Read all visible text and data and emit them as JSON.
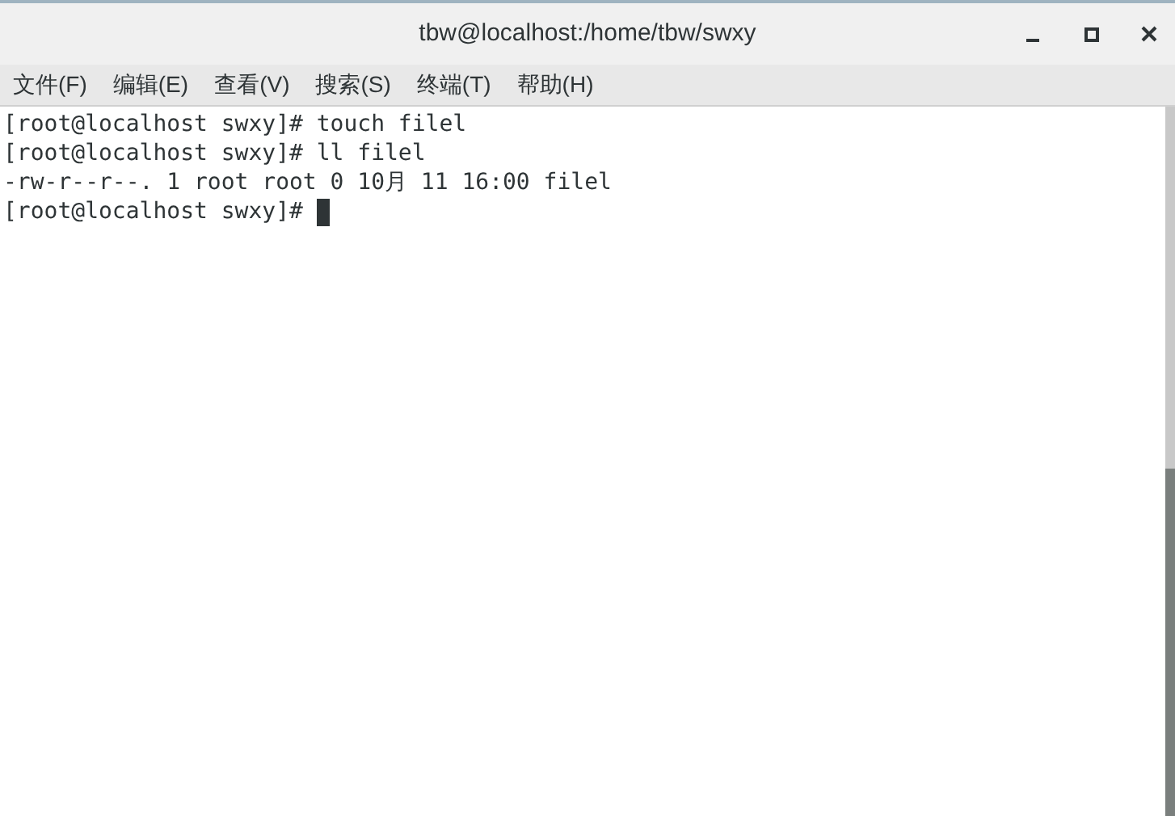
{
  "window": {
    "title": "tbw@localhost:/home/tbw/swxy"
  },
  "menu": [
    "文件(F)",
    "编辑(E)",
    "查看(V)",
    "搜索(S)",
    "终端(T)",
    "帮助(H)"
  ],
  "terminal": {
    "lines": [
      "[root@localhost swxy]# touch filel",
      "[root@localhost swxy]# ll filel",
      "-rw-r--r--. 1 root root 0 10月 11 16:00 filel",
      "[root@localhost swxy]# "
    ],
    "cursor": true
  }
}
